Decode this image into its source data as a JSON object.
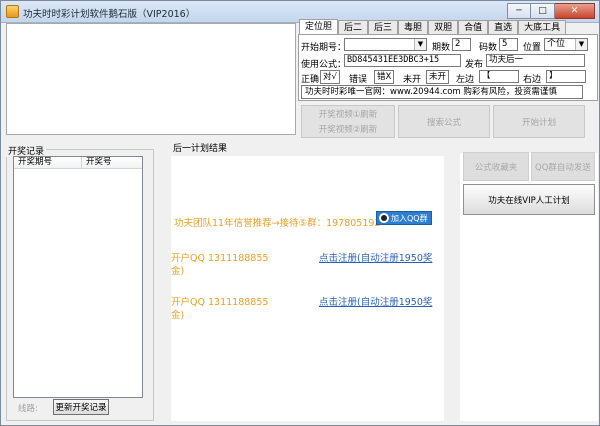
{
  "window": {
    "title": "功夫时时彩计划软件鹅石版（VIP2016）",
    "minimize": "─",
    "maximize": "□",
    "close": "✕"
  },
  "tabs": [
    {
      "label": "定位胆",
      "active": true
    },
    {
      "label": "后二"
    },
    {
      "label": "后三"
    },
    {
      "label": "毒胆"
    },
    {
      "label": "双胆"
    },
    {
      "label": "合值"
    },
    {
      "label": "直选"
    },
    {
      "label": "大底工具"
    }
  ],
  "form": {
    "start_period_label": "开始期号：",
    "start_period_value": "",
    "periods_label": "期数",
    "periods_value": "2",
    "codes_label": "码数",
    "codes_value": "5",
    "position_label": "位置",
    "position_value": "个位",
    "formula_label": "使用公式：",
    "formula_value": "BD845431EE3DBC3+15",
    "publish_label": "发布",
    "publish_value": "功夫后一",
    "correct_label": "正确",
    "correct_value": "对√",
    "wrong_label": "错误",
    "wrong_value": "错X",
    "notopen_label": "未开",
    "notopen_value": "未开",
    "left_label": "左边",
    "left_value": "【",
    "right_label": "右边",
    "right_value": "】",
    "slogan": "功夫时时彩唯一官网：www.20944.com 购彩有风险，投资需谨慎"
  },
  "actions": {
    "video1": "开奖视频①刷新",
    "video2": "开奖视频②刷新",
    "search_formula": "搜索公式",
    "start_plan": "开始计划"
  },
  "history": {
    "group_title": "开奖记录",
    "columns": [
      "开奖期号",
      "开奖号"
    ],
    "line_label": "线路:",
    "update_button": "更新开奖记录"
  },
  "result": {
    "title": "后一计划结果",
    "promo": "功夫团队11年信誉推荐→接待⑤群：197805192",
    "qq_group_badge": "加入QQ群",
    "qq_line1a": "开户QQ 1311188855",
    "link1a": "点击注册(自动注册1950奖",
    "link1b": "金)",
    "qq_line2a": "开户QQ 1311188855",
    "link2a": "点击注册(自动注册1950奖",
    "link2b": "金)"
  },
  "side": {
    "save_formula": "公式收藏夹",
    "auto_send": "QQ群自动发送",
    "vip_plan": "功夫在线VIP人工计划"
  }
}
